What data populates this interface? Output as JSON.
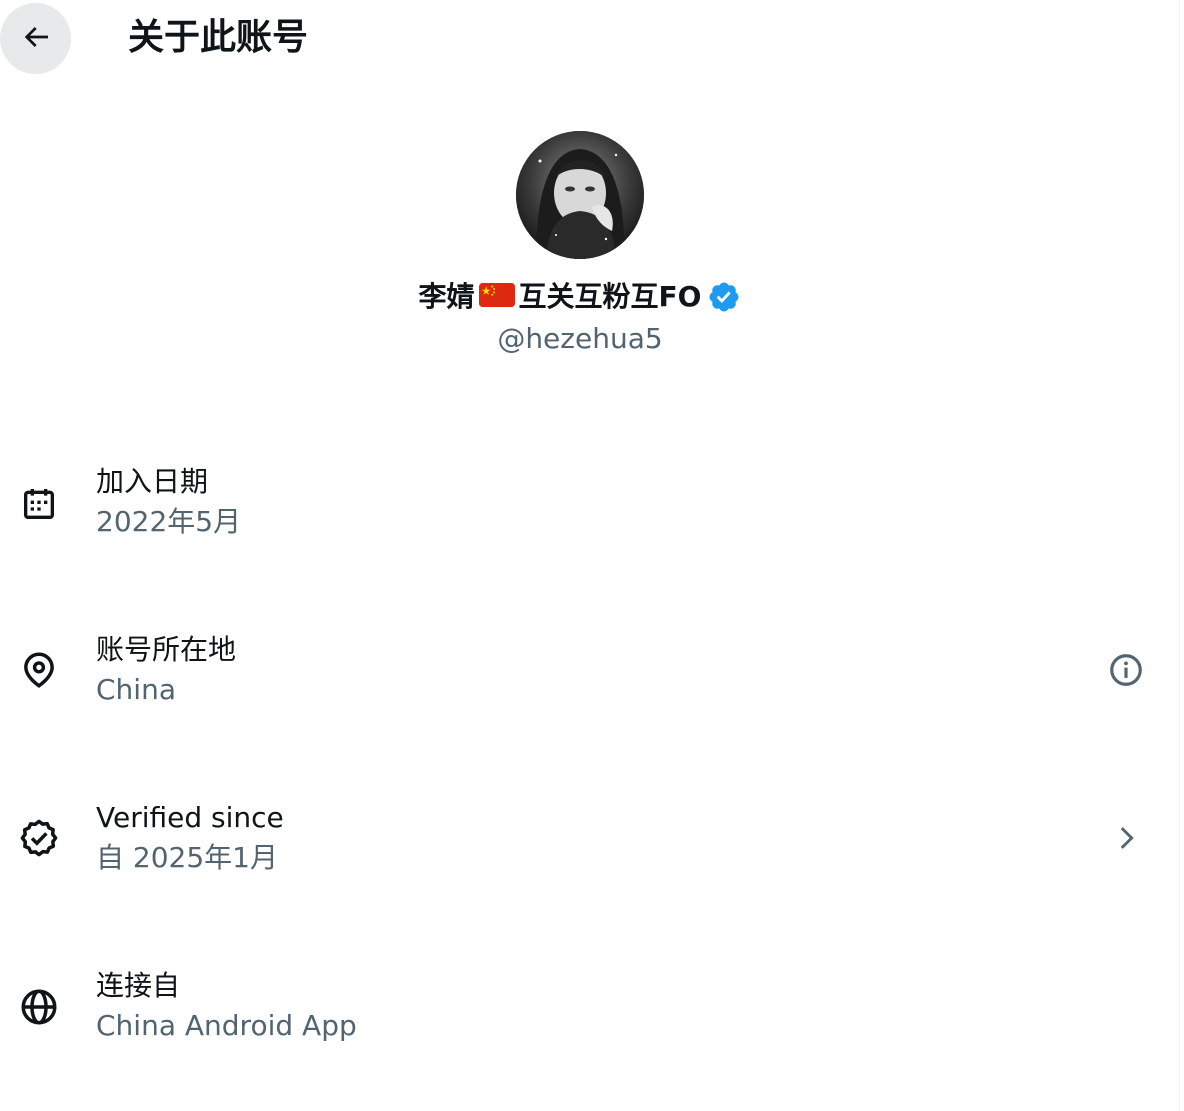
{
  "header": {
    "title": "关于此账号",
    "back_icon": "arrow-left-icon"
  },
  "profile": {
    "display_name_prefix": "李婧",
    "display_name_suffix": "互关互粉互FO",
    "flag_icon": "china-flag-icon",
    "verified_icon": "verified-badge-icon",
    "handle": "@hezehua5"
  },
  "details": {
    "joined": {
      "icon": "calendar-icon",
      "label": "加入日期",
      "value": "2022年5月"
    },
    "location": {
      "icon": "location-pin-icon",
      "label": "账号所在地",
      "value": "China",
      "action_icon": "info-icon"
    },
    "verified": {
      "icon": "verified-outline-icon",
      "label": "Verified since",
      "value": "自 2025年1月",
      "action_icon": "chevron-right-icon"
    },
    "connected": {
      "icon": "globe-icon",
      "label": "连接自",
      "value": "China Android App"
    }
  },
  "colors": {
    "text_primary": "#0f1419",
    "text_secondary": "#536471",
    "verified_blue": "#1d9bf0",
    "back_button_bg": "#e7e9ea"
  }
}
